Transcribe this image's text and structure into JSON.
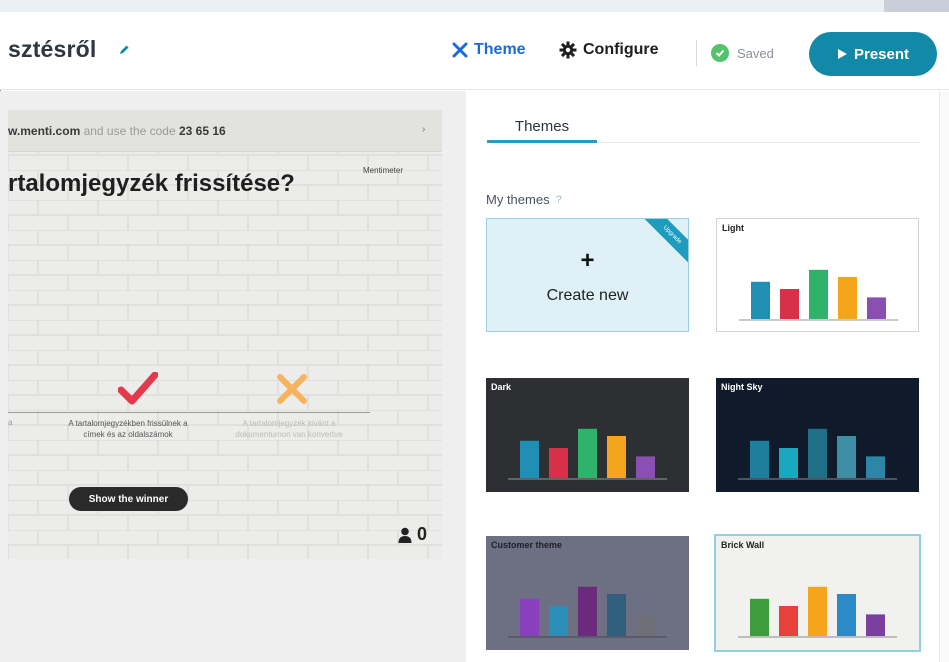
{
  "header": {
    "title": "sztésről",
    "theme_label": "Theme",
    "configure_label": "Configure",
    "saved_label": "Saved",
    "present_label": "Present"
  },
  "slide": {
    "instructions_prefix": "w.menti.com",
    "instructions_mid": " and use the code ",
    "code": "23 65 16",
    "brand": "Mentimeter",
    "question": "rtalomjegyzék frissítése?",
    "option0": "a",
    "option1": "A tartalomjegyzékben frissülnek a címek és az oldalszámok",
    "option2": "A tartalomjegyzék kivánt a dokumentumon van konvertve",
    "winner_button": "Show the winner",
    "votes": "0"
  },
  "panel": {
    "tab": "Themes",
    "section_title": "My themes",
    "help_mark": "?",
    "create_plus": "+",
    "create_label": "Create new",
    "ribbon": "Upgrade"
  },
  "themes": [
    {
      "name": "Light",
      "background": "#ffffff",
      "label_color": "#222222",
      "values": [
        0.62,
        0.5,
        0.82,
        0.7,
        0.36
      ],
      "colors": [
        "#1f8fb5",
        "#d9304a",
        "#2fb36a",
        "#f4a51c",
        "#8a4fb3"
      ]
    },
    {
      "name": "Dark",
      "background": "#2d2f33",
      "label_color": "#ffffff",
      "values": [
        0.62,
        0.5,
        0.82,
        0.7,
        0.36
      ],
      "colors": [
        "#1f8fb5",
        "#d9304a",
        "#2fb36a",
        "#f4a51c",
        "#8a4fb3"
      ]
    },
    {
      "name": "Night Sky",
      "background": "#0f1b2a",
      "label_color": "#ffffff",
      "values": [
        0.62,
        0.5,
        0.82,
        0.7,
        0.36
      ],
      "colors": [
        "#1e7f9c",
        "#19a8c0",
        "#1f6f87",
        "#3e8fa6",
        "#2d86a8"
      ]
    },
    {
      "name": "Customer theme",
      "background": "#6d6f82",
      "label_color": "#1e1e2a",
      "values": [
        0.62,
        0.5,
        0.82,
        0.7,
        0.36
      ],
      "colors": [
        "#8a3fbf",
        "#2c8fb8",
        "#6b2a7d",
        "#2f5f7a",
        "#6f6f7a"
      ]
    },
    {
      "name": "Brick Wall",
      "background": "#f1f1ef",
      "label_color": "#222222",
      "values": [
        0.62,
        0.5,
        0.82,
        0.7,
        0.36
      ],
      "colors": [
        "#3f9c3a",
        "#e8413c",
        "#f4a51c",
        "#2b8ac8",
        "#7b3fa0"
      ]
    }
  ]
}
